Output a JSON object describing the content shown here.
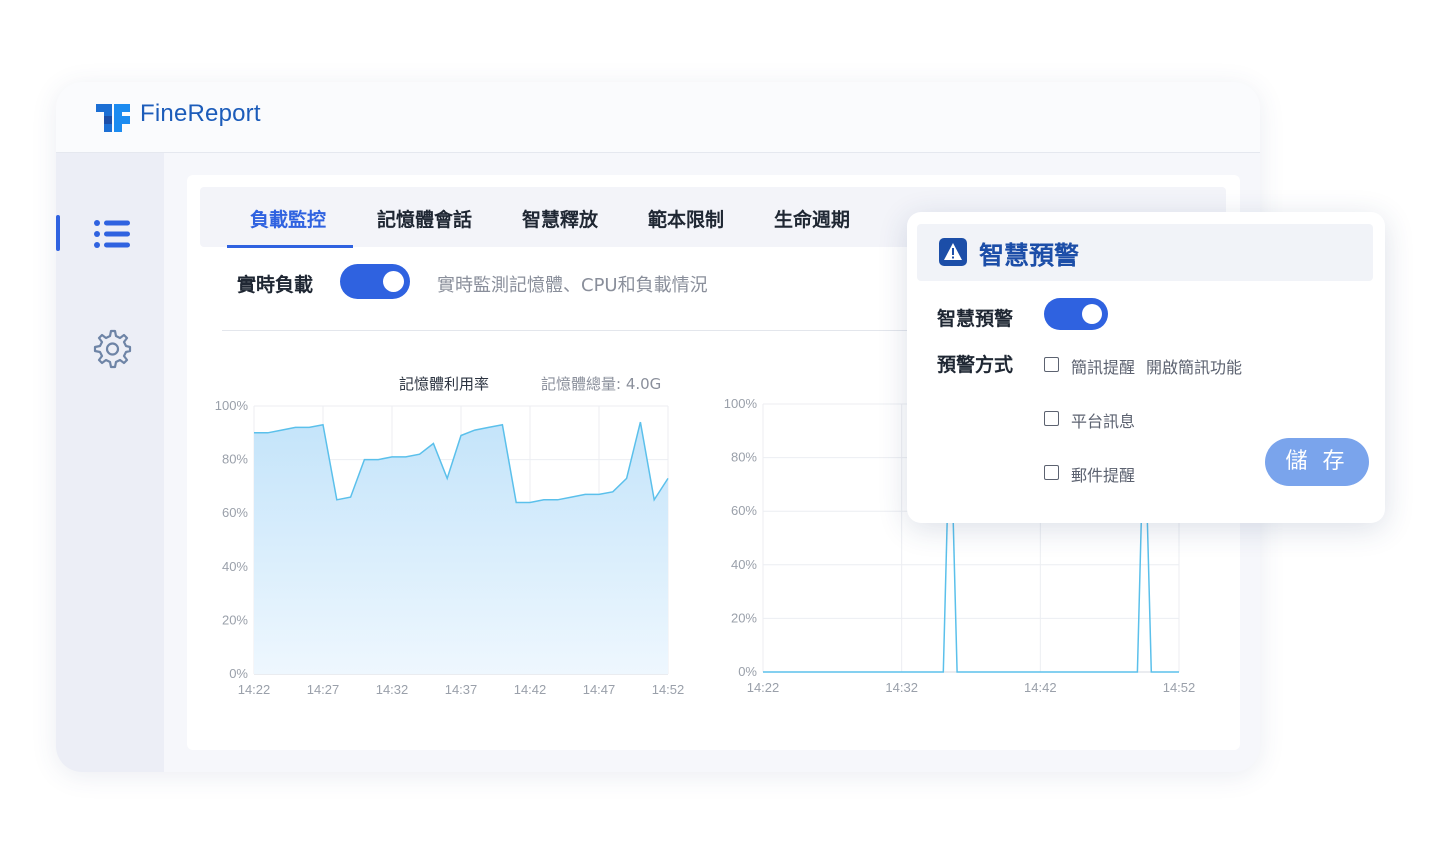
{
  "app": {
    "brand": "FineReport"
  },
  "sidebar": {
    "items": [
      {
        "icon": "list-icon",
        "active": true
      },
      {
        "icon": "gear-icon",
        "active": false
      }
    ]
  },
  "tabs": [
    {
      "label": "負載監控",
      "active": true
    },
    {
      "label": "記憶體會話",
      "active": false
    },
    {
      "label": "智慧釋放",
      "active": false
    },
    {
      "label": "範本限制",
      "active": false
    },
    {
      "label": "生命週期",
      "active": false
    }
  ],
  "realtime": {
    "label": "實時負載",
    "enabled": true,
    "desc": "實時監測記憶體、CPU和負載情況"
  },
  "colors": {
    "accent": "#2f62e0",
    "line": "#5bc0eb",
    "area": "#cfe9fb",
    "save": "#7aa4ec"
  },
  "chart_data": [
    {
      "type": "area",
      "title": "記憶體利用率",
      "subtitle": "記憶體總量: 4.0G",
      "ylim": [
        0,
        100
      ],
      "yticks": [
        "0%",
        "20%",
        "40%",
        "60%",
        "80%",
        "100%"
      ],
      "xticks": [
        "14:22",
        "14:27",
        "14:32",
        "14:37",
        "14:42",
        "14:47",
        "14:52"
      ],
      "x": [
        0,
        1,
        2,
        3,
        4,
        5,
        6,
        7,
        8,
        9,
        10,
        11,
        12,
        13,
        14,
        15,
        16,
        17,
        18,
        19,
        20,
        21,
        22,
        23,
        24,
        25,
        26,
        27,
        28,
        29,
        30
      ],
      "values": [
        90,
        90,
        91,
        92,
        92,
        93,
        65,
        66,
        80,
        80,
        81,
        81,
        82,
        86,
        73,
        89,
        91,
        92,
        93,
        64,
        64,
        65,
        65,
        66,
        67,
        67,
        68,
        73,
        94,
        65,
        73
      ],
      "grid": true
    },
    {
      "type": "line",
      "ylim": [
        0,
        100
      ],
      "yticks": [
        "0%",
        "20%",
        "40%",
        "60%",
        "80%",
        "100%"
      ],
      "xticks": [
        "14:22",
        "14:32",
        "14:42",
        "14:52"
      ],
      "x": [
        0,
        13,
        13.5,
        14,
        27,
        27.5,
        28,
        30
      ],
      "values": [
        0,
        0,
        100,
        0,
        0,
        100,
        0,
        0
      ],
      "grid": true
    }
  ],
  "alert": {
    "title": "智慧預警",
    "toggle_label": "智慧預警",
    "toggle_on": true,
    "method_label": "預警方式",
    "options": [
      {
        "label": "簡訊提醒",
        "checked": false,
        "extra": "開啟簡訊功能"
      },
      {
        "label": "平台訊息",
        "checked": false
      },
      {
        "label": "郵件提醒",
        "checked": false
      }
    ],
    "save_label": "儲 存"
  }
}
